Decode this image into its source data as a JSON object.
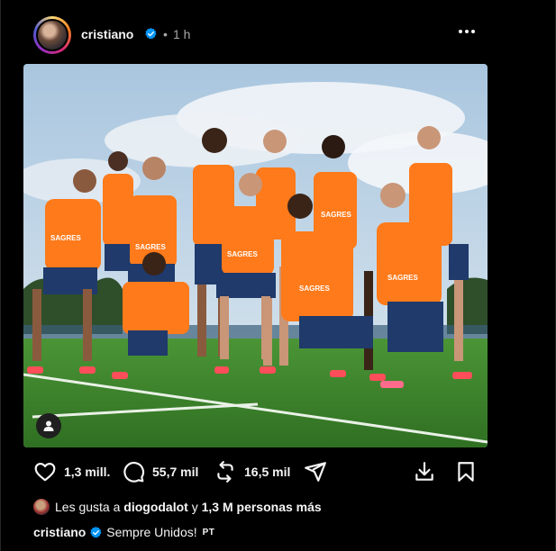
{
  "post": {
    "author": "cristiano",
    "separator": "•",
    "time": "1 h"
  },
  "actions": {
    "likes": "1,3 mill.",
    "comments": "55,7 mil",
    "reposts": "16,5 mil"
  },
  "liked_by": {
    "prefix": "Les gusta a",
    "user": "diogodalot",
    "connector": "y",
    "others": "1,3 M personas más"
  },
  "caption": {
    "author": "cristiano",
    "text": "Sempre Unidos!",
    "translation_badge": "PT"
  },
  "photo": {
    "bib_text": "SAGRES"
  },
  "colors": {
    "verified": "#0095f6",
    "bib": "#ff7a1a",
    "pitch": "#3f8a2e"
  },
  "icons": [
    "more-options-icon",
    "verified-badge-icon",
    "heart-icon",
    "comment-icon",
    "repost-icon",
    "share-icon",
    "save-icon",
    "user-tag-icon"
  ]
}
